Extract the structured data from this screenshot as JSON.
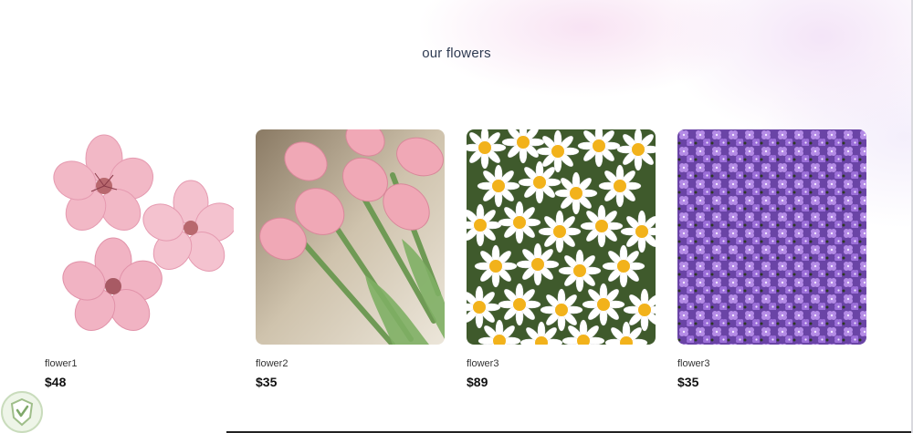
{
  "section": {
    "title": "our flowers"
  },
  "products": [
    {
      "name": "flower1",
      "price": "$48",
      "image_icon": "cherry-blossom-image"
    },
    {
      "name": "flower2",
      "price": "$35",
      "image_icon": "pink-tulips-image"
    },
    {
      "name": "flower3",
      "price": "$89",
      "image_icon": "daisies-image"
    },
    {
      "name": "flower3",
      "price": "$35",
      "image_icon": "purple-flowers-image"
    }
  ],
  "colors": {
    "background": "#ffffff",
    "title_text": "#2f3b52",
    "price_text": "#111111",
    "gradient_pink": "#f5d7ee",
    "gradient_lavender": "#f0dcf5"
  }
}
